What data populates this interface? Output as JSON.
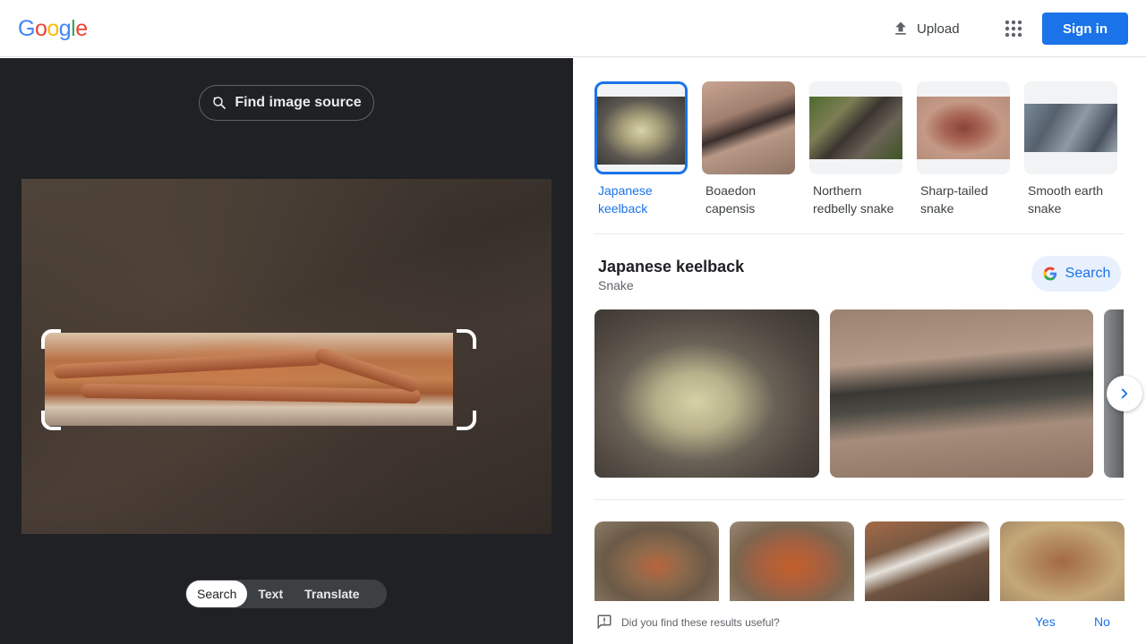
{
  "header": {
    "logo_letters": [
      {
        "ch": "G",
        "color": "#4285F4"
      },
      {
        "ch": "o",
        "color": "#EA4335"
      },
      {
        "ch": "o",
        "color": "#FBBC05"
      },
      {
        "ch": "g",
        "color": "#4285F4"
      },
      {
        "ch": "l",
        "color": "#34A853"
      },
      {
        "ch": "e",
        "color": "#EA4335"
      }
    ],
    "upload_label": "Upload",
    "upload_icon": "upload-icon",
    "apps_icon": "apps-grid-icon",
    "signin_label": "Sign in"
  },
  "left": {
    "find_source_label": "Find image source",
    "find_source_icon": "lens-search-icon",
    "modes": [
      {
        "label": "Search",
        "active": true
      },
      {
        "label": "Text",
        "active": false
      },
      {
        "label": "Translate",
        "active": false
      }
    ]
  },
  "matches": [
    {
      "label": "Japanese keelback",
      "selected": true
    },
    {
      "label": "Boaedon capensis",
      "selected": false
    },
    {
      "label": "Northern redbelly snake",
      "selected": false
    },
    {
      "label": "Sharp-tailed snake",
      "selected": false
    },
    {
      "label": "Smooth earth snake",
      "selected": false
    }
  ],
  "entity": {
    "title": "Japanese keelback",
    "subtitle": "Snake",
    "search_label": "Search"
  },
  "feedback": {
    "question": "Did you find these results useful?",
    "yes": "Yes",
    "no": "No"
  },
  "colors": {
    "accent": "#1a73e8",
    "dark_pane": "#202124"
  }
}
